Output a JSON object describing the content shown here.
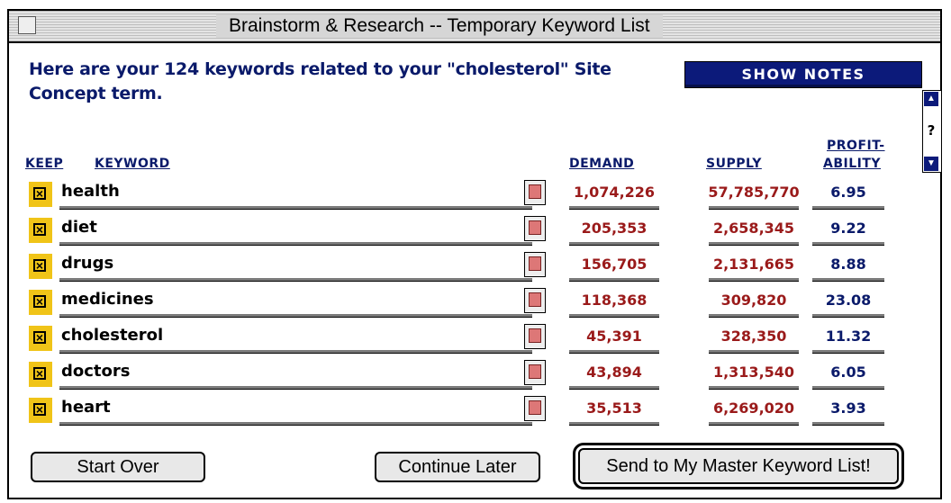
{
  "window": {
    "title": "Brainstorm & Research -- Temporary Keyword List"
  },
  "intro": {
    "text": "Here are your 124 keywords related to your \"cholesterol\" Site Concept term."
  },
  "buttons": {
    "show_notes": "SHOW NOTES",
    "start_over": "Start Over",
    "continue_later": "Continue Later",
    "send": "Send to My Master Keyword List!"
  },
  "scroll": {
    "help": "?"
  },
  "headers": {
    "keep": "KEEP",
    "keyword": "KEYWORD",
    "demand": "DEMAND",
    "supply": "SUPPLY",
    "profit_1": "PROFIT-",
    "profit_2": "ABILITY"
  },
  "rows": [
    {
      "keep": true,
      "keyword": "health",
      "demand": "1,074,226",
      "supply": "57,785,770",
      "profitability": "6.95"
    },
    {
      "keep": true,
      "keyword": "diet",
      "demand": "205,353",
      "supply": "2,658,345",
      "profitability": "9.22"
    },
    {
      "keep": true,
      "keyword": "drugs",
      "demand": "156,705",
      "supply": "2,131,665",
      "profitability": "8.88"
    },
    {
      "keep": true,
      "keyword": "medicines",
      "demand": "118,368",
      "supply": "309,820",
      "profitability": "23.08"
    },
    {
      "keep": true,
      "keyword": "cholesterol",
      "demand": "45,391",
      "supply": "328,350",
      "profitability": "11.32"
    },
    {
      "keep": true,
      "keyword": "doctors",
      "demand": "43,894",
      "supply": "1,313,540",
      "profitability": "6.05"
    },
    {
      "keep": true,
      "keyword": "heart",
      "demand": "35,513",
      "supply": "6,269,020",
      "profitability": "3.93"
    }
  ],
  "colors": {
    "accent": "#0c1a7a",
    "numbers": "#9a1a1a",
    "checkbox": "#f0c418"
  }
}
